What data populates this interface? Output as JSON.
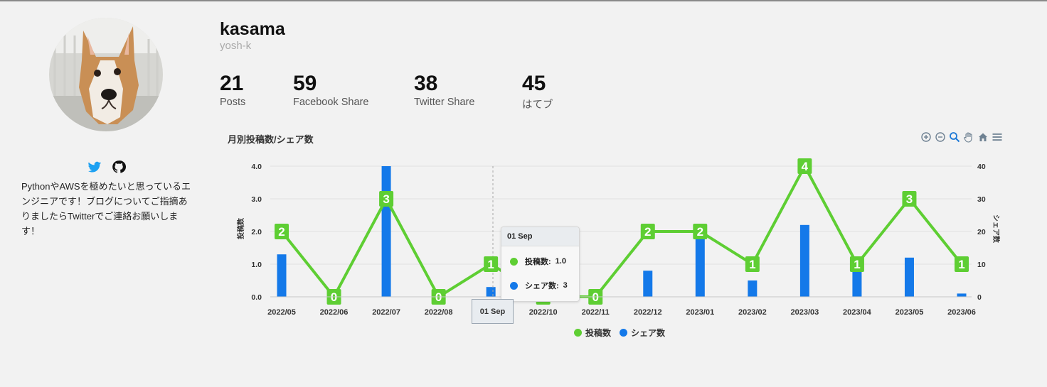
{
  "profile": {
    "name": "kasama",
    "username": "yosh-k",
    "bio": "PythonやAWSを極めたいと思っているエンジニアです！ブログについてご指摘ありましたらTwitterでご連絡お願いします！",
    "social": [
      "twitter-icon",
      "github-icon"
    ]
  },
  "stats": [
    {
      "value": "21",
      "label": "Posts"
    },
    {
      "value": "59",
      "label": "Facebook Share"
    },
    {
      "value": "38",
      "label": "Twitter Share"
    },
    {
      "value": "45",
      "label": "はてブ"
    }
  ],
  "toolbar": [
    "zoom-in-icon",
    "zoom-out-icon",
    "zoom-select-icon",
    "pan-icon",
    "reset-home-icon",
    "menu-icon"
  ],
  "tooltip": {
    "header": "01 Sep",
    "rows": [
      {
        "label": "投稿数:",
        "value": "1.0"
      },
      {
        "label": "シェア数:",
        "value": "3"
      }
    ],
    "xlabel": "01 Sep"
  },
  "colors": {
    "posts": "#5ece33",
    "shares": "#1479e9",
    "background": "#f2f2f2"
  },
  "chart_data": {
    "type": "bar",
    "title": "月別投稿数/シェア数",
    "categories": [
      "2022/05",
      "2022/06",
      "2022/07",
      "2022/08",
      "2022/09",
      "2022/10",
      "2022/11",
      "2022/12",
      "2023/01",
      "2023/02",
      "2023/03",
      "2023/04",
      "2023/05",
      "2023/06"
    ],
    "x_tick_labels": [
      "2022/05",
      "2022/06",
      "2022/07",
      "2022/08",
      "",
      "2022/10",
      "2022/11",
      "2022/12",
      "2023/01",
      "2023/02",
      "2023/03",
      "2023/04",
      "2023/05",
      "2023/06"
    ],
    "series": [
      {
        "name": "投稿数",
        "type": "line",
        "axis": "left",
        "values": [
          2,
          0,
          3,
          0,
          1,
          0,
          0,
          2,
          2,
          1,
          4,
          1,
          3,
          1
        ]
      },
      {
        "name": "シェア数",
        "type": "bar",
        "axis": "right",
        "values": [
          13,
          0,
          40,
          0,
          3,
          0,
          0,
          8,
          18,
          5,
          22,
          8,
          12,
          1
        ]
      }
    ],
    "ylabel_left": "投稿数",
    "ylabel_right": "シェア数",
    "ylim_left": [
      0,
      4
    ],
    "ylim_right": [
      0,
      40
    ],
    "yticks_left": [
      "0.0",
      "1.0",
      "2.0",
      "3.0",
      "4.0"
    ],
    "yticks_right": [
      "0",
      "10",
      "20",
      "30",
      "40"
    ],
    "grid": true,
    "legend": "bottom-center"
  }
}
